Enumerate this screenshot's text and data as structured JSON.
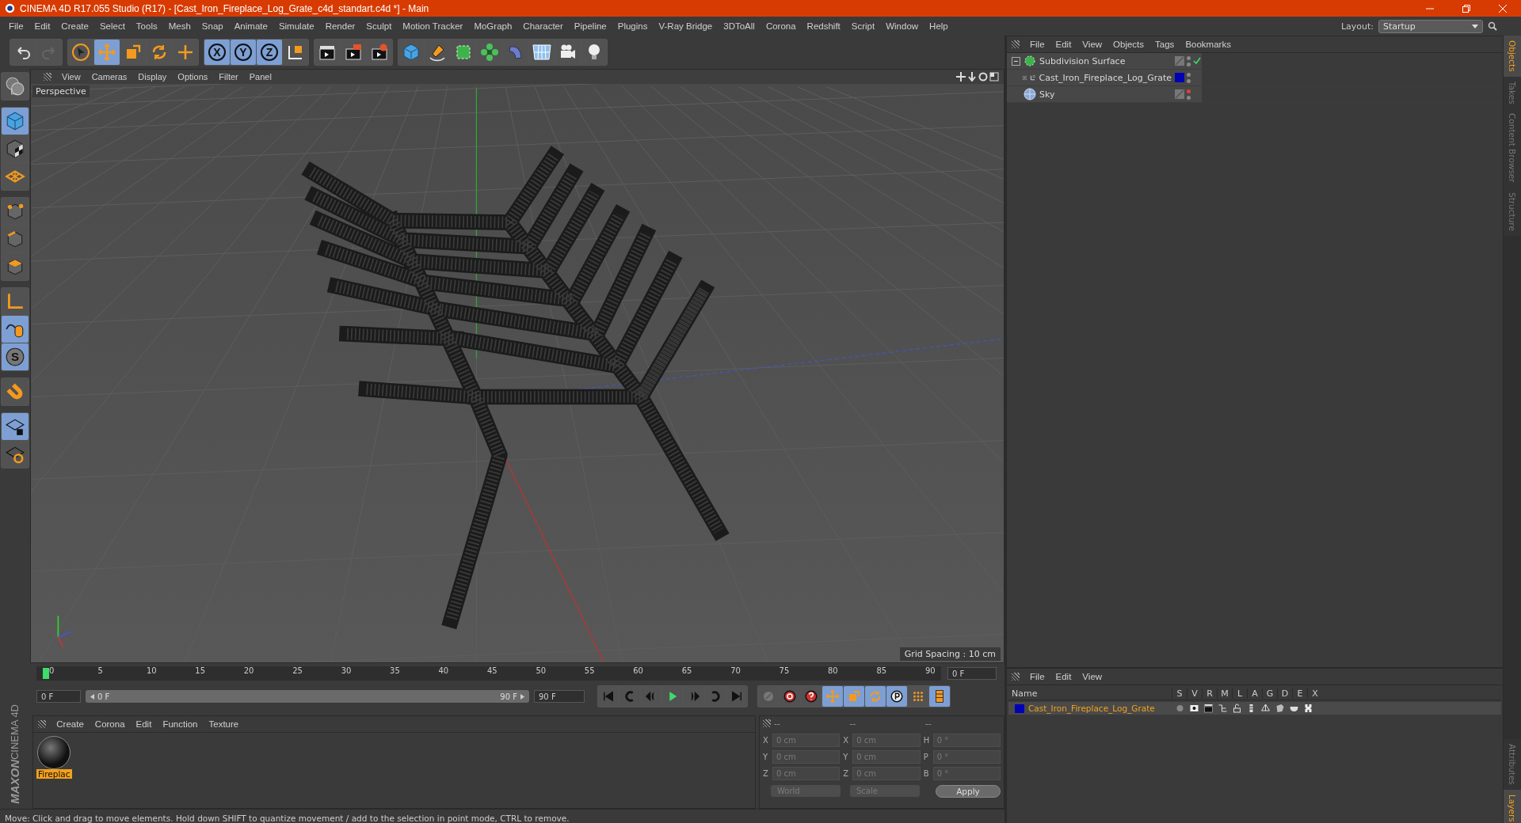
{
  "window": {
    "title": "CINEMA 4D R17.055 Studio (R17) - [Cast_Iron_Fireplace_Log_Grate_c4d_standart.c4d *] - Main"
  },
  "menu": [
    "File",
    "Edit",
    "Create",
    "Select",
    "Tools",
    "Mesh",
    "Snap",
    "Animate",
    "Simulate",
    "Render",
    "Sculpt",
    "Motion Tracker",
    "MoGraph",
    "Character",
    "Pipeline",
    "Plugins",
    "V-Ray Bridge",
    "3DToAll",
    "Corona",
    "Redshift",
    "Script",
    "Window",
    "Help"
  ],
  "layout": {
    "label": "Layout:",
    "value": "Startup"
  },
  "toolbar": [
    {
      "items": [
        {
          "kind": "undo",
          "selected": false
        },
        {
          "kind": "redo",
          "selected": false
        }
      ]
    },
    {
      "items": [
        {
          "kind": "cursor",
          "selected": false
        },
        {
          "kind": "move",
          "selected": true
        },
        {
          "kind": "scale",
          "selected": false
        },
        {
          "kind": "rotate",
          "selected": false
        },
        {
          "kind": "cross",
          "selected": false
        }
      ]
    },
    {
      "items": [
        {
          "kind": "axis-letter",
          "label": "X",
          "selected": true
        },
        {
          "kind": "axis-letter",
          "label": "Y",
          "selected": true
        },
        {
          "kind": "axis-letter",
          "label": "Z",
          "selected": true
        },
        {
          "kind": "coords",
          "selected": false
        }
      ]
    },
    {
      "items": [
        {
          "kind": "clapper",
          "selected": false
        },
        {
          "kind": "clapper-play",
          "selected": false
        },
        {
          "kind": "clapper-gear",
          "selected": false
        }
      ]
    },
    {
      "items": [
        {
          "kind": "cube",
          "selected": false
        },
        {
          "kind": "pen",
          "selected": false
        },
        {
          "kind": "sub-cube",
          "selected": false
        },
        {
          "kind": "flower",
          "selected": false
        },
        {
          "kind": "bend",
          "selected": false
        },
        {
          "kind": "floor",
          "selected": false
        },
        {
          "kind": "camera",
          "selected": false
        },
        {
          "kind": "bulb",
          "selected": false
        }
      ]
    }
  ],
  "left_toolbar": [
    {
      "items": [
        {
          "kind": "globe",
          "selected": false
        }
      ]
    },
    {
      "items": [
        {
          "kind": "cube",
          "selected": true
        },
        {
          "kind": "checker-cube",
          "selected": false
        },
        {
          "kind": "grid",
          "selected": false
        }
      ]
    },
    {
      "items": [
        {
          "kind": "points-cube",
          "selected": false
        },
        {
          "kind": "edges-cube",
          "selected": false
        },
        {
          "kind": "poly-cube",
          "selected": false
        }
      ]
    },
    {
      "items": [
        {
          "kind": "axis",
          "selected": false
        },
        {
          "kind": "mouse",
          "selected": true
        },
        {
          "kind": "s-circle",
          "label": "S",
          "selected": true
        }
      ]
    },
    {
      "items": [
        {
          "kind": "magnet",
          "selected": false
        }
      ]
    },
    {
      "items": [
        {
          "kind": "grid-lock",
          "selected": true
        },
        {
          "kind": "grid-sync",
          "selected": false
        }
      ]
    }
  ],
  "viewport": {
    "menu": [
      "View",
      "Cameras",
      "Display",
      "Options",
      "Filter",
      "Panel"
    ],
    "label": "Perspective",
    "grid_spacing": "Grid Spacing : 10 cm"
  },
  "timeline": {
    "ticks": [
      "0",
      "5",
      "10",
      "15",
      "20",
      "25",
      "30",
      "35",
      "40",
      "45",
      "50",
      "55",
      "60",
      "65",
      "70",
      "75",
      "80",
      "85",
      "90"
    ],
    "current_frame": "0 F",
    "start": "0 F",
    "level": 1,
    "range_start": "0 F",
    "range_end": "90 F",
    "end": "90 F",
    "playback": [
      {
        "kind": "to-start",
        "selected": false
      },
      {
        "kind": "prev-key",
        "selected": false
      },
      {
        "kind": "prev-frame",
        "selected": false
      },
      {
        "kind": "play",
        "selected": false
      },
      {
        "kind": "next-frame",
        "selected": false
      },
      {
        "kind": "next-key",
        "selected": false
      },
      {
        "kind": "to-end",
        "selected": false
      }
    ],
    "keys": [
      {
        "kind": "key-off",
        "selected": false
      },
      {
        "kind": "record",
        "selected": false
      },
      {
        "kind": "autokey",
        "selected": false
      },
      {
        "kind": "move",
        "selected": true
      },
      {
        "kind": "scale",
        "selected": true
      },
      {
        "kind": "rotate",
        "selected": true
      },
      {
        "kind": "param",
        "selected": true
      },
      {
        "kind": "dots",
        "selected": false
      },
      {
        "kind": "film",
        "selected": true
      }
    ]
  },
  "material_manager": {
    "menu": [
      "Create",
      "Corona",
      "Edit",
      "Function",
      "Texture"
    ],
    "materials": [
      {
        "name": "Fireplac",
        "selected": true
      }
    ]
  },
  "coordinates": {
    "columns": [
      {
        "header": "--",
        "rows": [
          {
            "axis": "X",
            "value": "0 cm"
          },
          {
            "axis": "Y",
            "value": "0 cm"
          },
          {
            "axis": "Z",
            "value": "0 cm"
          }
        ]
      },
      {
        "header": "--",
        "rows": [
          {
            "axis": "X",
            "value": "0 cm"
          },
          {
            "axis": "Y",
            "value": "0 cm"
          },
          {
            "axis": "Z",
            "value": "0 cm"
          }
        ]
      },
      {
        "header": "--",
        "rows": [
          {
            "axis": "H",
            "value": "0 °"
          },
          {
            "axis": "P",
            "value": "0 °"
          },
          {
            "axis": "B",
            "value": "0 °"
          }
        ]
      }
    ],
    "disabled": true,
    "dropdowns": [
      "World",
      "Scale"
    ],
    "apply": "Apply"
  },
  "logo": {
    "brand": "MAXON",
    "product": "CINEMA 4D"
  },
  "status_bar": "Move: Click and drag to move elements. Hold down SHIFT to quantize movement / add to the selection in point mode, CTRL to remove.",
  "object_manager": {
    "menu": [
      "File",
      "Edit",
      "View",
      "Objects",
      "Tags",
      "Bookmarks"
    ],
    "objects": [
      {
        "name": "Subdivision Surface",
        "kind": "subdivision",
        "expanded": true,
        "checked": true,
        "hidden": false,
        "children": [
          {
            "name": "Cast_Iron_Fireplace_Log_Grate",
            "kind": "null",
            "expanded": false,
            "checked": false,
            "hidden": false,
            "color": "#0000b4"
          }
        ]
      },
      {
        "name": "Sky",
        "kind": "sky",
        "checked": false,
        "hidden": true
      }
    ]
  },
  "layer_manager": {
    "menu": [
      "File",
      "Edit",
      "View"
    ],
    "columns": [
      "Name",
      "S",
      "V",
      "R",
      "M",
      "L",
      "A",
      "G",
      "D",
      "E",
      "X"
    ],
    "layers": [
      {
        "name": "Cast_Iron_Fireplace_Log_Grate",
        "color": "#0000b4",
        "selected": true
      }
    ]
  },
  "side_tabs_top": [
    {
      "label": "Objects",
      "selected": true
    },
    {
      "label": "Takes",
      "selected": false
    },
    {
      "label": "Content Browser",
      "selected": false
    },
    {
      "label": "Structure",
      "selected": false
    }
  ],
  "side_tabs_bottom": [
    {
      "label": "Attributes",
      "selected": false
    },
    {
      "label": "Layers",
      "selected": true
    }
  ]
}
